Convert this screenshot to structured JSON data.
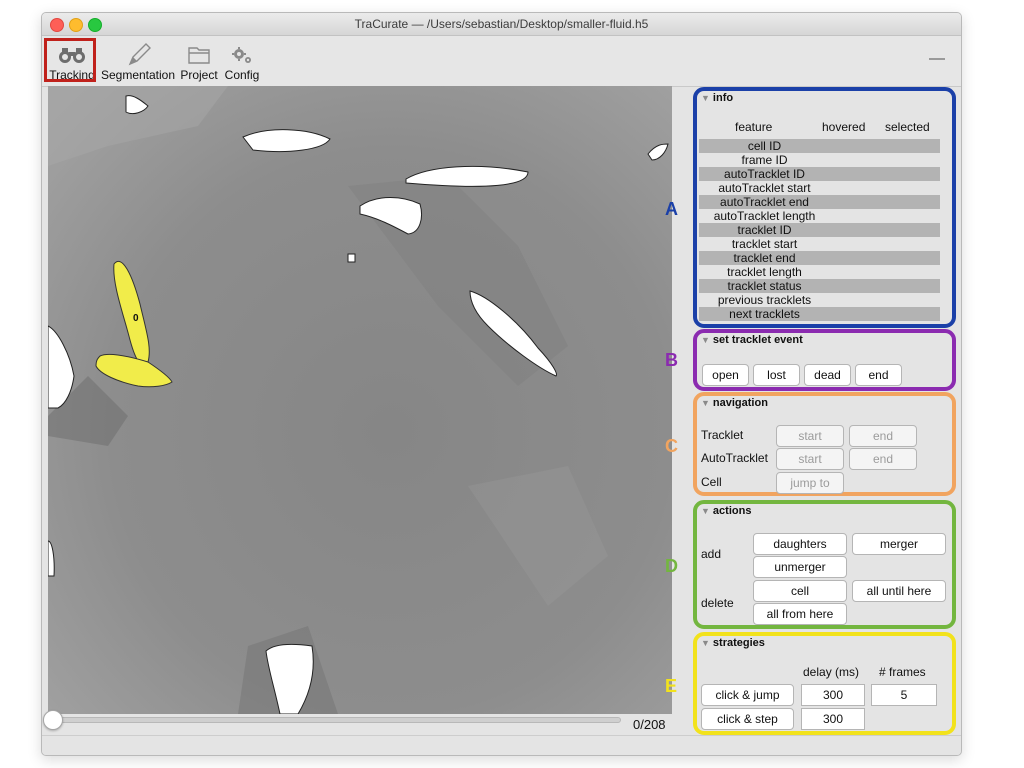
{
  "window": {
    "title": "TraCurate — /Users/sebastian/Desktop/smaller-fluid.h5"
  },
  "toolbar": {
    "tracking": "Tracking",
    "segmentation": "Segmentation",
    "project": "Project",
    "config": "Config"
  },
  "timeline": {
    "frame_label": "0/208",
    "position": 0.0
  },
  "canvas": {
    "selected_object_label": "0",
    "highlight_color": "#f1ec4a"
  },
  "panels": {
    "info": {
      "letter": "A",
      "title": "info",
      "columns": [
        "feature",
        "hovered",
        "selected"
      ],
      "rows": [
        "cell ID",
        "frame ID",
        "autoTracklet ID",
        "autoTracklet start",
        "autoTracklet end",
        "autoTracklet length",
        "tracklet ID",
        "tracklet start",
        "tracklet end",
        "tracklet length",
        "tracklet status",
        "previous tracklets",
        "next tracklets"
      ]
    },
    "event": {
      "letter": "B",
      "title": "set tracklet event",
      "buttons": [
        "open",
        "lost",
        "dead",
        "end"
      ]
    },
    "navigation": {
      "letter": "C",
      "title": "navigation",
      "tracklet_label": "Tracklet",
      "autotracklet_label": "AutoTracklet",
      "cell_label": "Cell",
      "start": "start",
      "end": "end",
      "jump_to": "jump to"
    },
    "actions": {
      "letter": "D",
      "title": "actions",
      "add_label": "add",
      "delete_label": "delete",
      "daughters": "daughters",
      "merger": "merger",
      "unmerger": "unmerger",
      "cell": "cell",
      "all_until_here": "all until here",
      "all_from_here": "all from here"
    },
    "strategies": {
      "letter": "E",
      "title": "strategies",
      "delay_header": "delay (ms)",
      "frames_header": "# frames",
      "click_jump": "click & jump",
      "click_step": "click & step",
      "jump_delay": "300",
      "jump_frames": "5",
      "step_delay": "300"
    }
  },
  "colors": {
    "info": "#1b40a8",
    "event": "#8b2bb0",
    "navigation": "#f1a45f",
    "actions": "#73b63f",
    "strategies": "#f2e21c",
    "selection": "#c0211b"
  }
}
